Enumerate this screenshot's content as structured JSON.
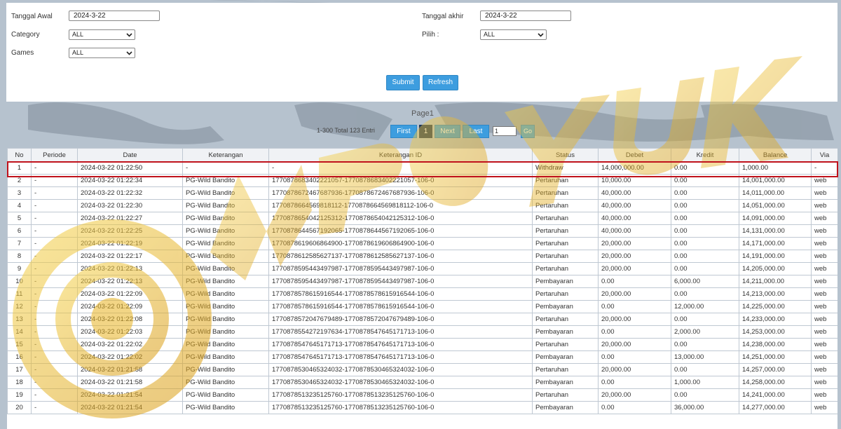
{
  "filters": {
    "start_date_label": "Tanggal Awal",
    "start_date_value": "2024-3-22",
    "end_date_label": "Tanggal akhir",
    "end_date_value": "2024-3-22",
    "category_label": "Category",
    "category_value": "ALL",
    "pilih_label": "Pilih  :",
    "pilih_value": "ALL",
    "games_label": "Games",
    "games_value": "ALL",
    "submit_label": "Submit",
    "refresh_label": "Refresh"
  },
  "pagination": {
    "page_title": "Page1",
    "total_text": "1-300 Total 123 Entri",
    "first_label": "First",
    "current_page": "1",
    "next_label": "Next",
    "last_label": "Last",
    "page_input_value": "1",
    "go_label": "Go"
  },
  "table": {
    "columns": [
      "No",
      "Periode",
      "Date",
      "Keterangan",
      "Keterangan ID",
      "Status",
      "Debet",
      "Kredit",
      "Balance",
      "Via"
    ],
    "rows": [
      [
        "1",
        "-",
        "2024-03-22 01:22:50",
        "-",
        "-",
        "Withdraw",
        "14,000,000.00",
        "0.00",
        "1,000.00",
        "-"
      ],
      [
        "2",
        "-",
        "2024-03-22 01:22:34",
        "PG-Wild Bandito",
        "1770878683402221057-1770878683402221057-106-0",
        "Pertaruhan",
        "10,000.00",
        "0.00",
        "14,001,000.00",
        "web"
      ],
      [
        "3",
        "-",
        "2024-03-22 01:22:32",
        "PG-Wild Bandito",
        "1770878672467687936-1770878672467687936-106-0",
        "Pertaruhan",
        "40,000.00",
        "0.00",
        "14,011,000.00",
        "web"
      ],
      [
        "4",
        "-",
        "2024-03-22 01:22:30",
        "PG-Wild Bandito",
        "1770878664569818112-1770878664569818112-106-0",
        "Pertaruhan",
        "40,000.00",
        "0.00",
        "14,051,000.00",
        "web"
      ],
      [
        "5",
        "-",
        "2024-03-22 01:22:27",
        "PG-Wild Bandito",
        "1770878654042125312-1770878654042125312-106-0",
        "Pertaruhan",
        "40,000.00",
        "0.00",
        "14,091,000.00",
        "web"
      ],
      [
        "6",
        "-",
        "2024-03-22 01:22:25",
        "PG-Wild Bandito",
        "1770878644567192065-1770878644567192065-106-0",
        "Pertaruhan",
        "40,000.00",
        "0.00",
        "14,131,000.00",
        "web"
      ],
      [
        "7",
        "-",
        "2024-03-22 01:22:19",
        "PG-Wild Bandito",
        "1770878619606864900-1770878619606864900-106-0",
        "Pertaruhan",
        "20,000.00",
        "0.00",
        "14,171,000.00",
        "web"
      ],
      [
        "8",
        "-",
        "2024-03-22 01:22:17",
        "PG-Wild Bandito",
        "1770878612585627137-1770878612585627137-106-0",
        "Pertaruhan",
        "20,000.00",
        "0.00",
        "14,191,000.00",
        "web"
      ],
      [
        "9",
        "-",
        "2024-03-22 01:22:13",
        "PG-Wild Bandito",
        "1770878595443497987-1770878595443497987-106-0",
        "Pertaruhan",
        "20,000.00",
        "0.00",
        "14,205,000.00",
        "web"
      ],
      [
        "10",
        "-",
        "2024-03-22 01:22:13",
        "PG-Wild Bandito",
        "1770878595443497987-1770878595443497987-106-0",
        "Pembayaran",
        "0.00",
        "6,000.00",
        "14,211,000.00",
        "web"
      ],
      [
        "11",
        "-",
        "2024-03-22 01:22:09",
        "PG-Wild Bandito",
        "1770878578615916544-1770878578615916544-106-0",
        "Pertaruhan",
        "20,000.00",
        "0.00",
        "14,213,000.00",
        "web"
      ],
      [
        "12",
        "-",
        "2024-03-22 01:22:09",
        "PG-Wild Bandito",
        "1770878578615916544-1770878578615916544-106-0",
        "Pembayaran",
        "0.00",
        "12,000.00",
        "14,225,000.00",
        "web"
      ],
      [
        "13",
        "-",
        "2024-03-22 01:22:08",
        "PG-Wild Bandito",
        "1770878572047679489-1770878572047679489-106-0",
        "Pertaruhan",
        "20,000.00",
        "0.00",
        "14,233,000.00",
        "web"
      ],
      [
        "14",
        "-",
        "2024-03-22 01:22:03",
        "PG-Wild Bandito",
        "1770878554272197634-1770878547645171713-106-0",
        "Pembayaran",
        "0.00",
        "2,000.00",
        "14,253,000.00",
        "web"
      ],
      [
        "15",
        "-",
        "2024-03-22 01:22:02",
        "PG-Wild Bandito",
        "1770878547645171713-1770878547645171713-106-0",
        "Pertaruhan",
        "20,000.00",
        "0.00",
        "14,238,000.00",
        "web"
      ],
      [
        "16",
        "-",
        "2024-03-22 01:22:02",
        "PG-Wild Bandito",
        "1770878547645171713-1770878547645171713-106-0",
        "Pembayaran",
        "0.00",
        "13,000.00",
        "14,251,000.00",
        "web"
      ],
      [
        "17",
        "-",
        "2024-03-22 01:21:58",
        "PG-Wild Bandito",
        "1770878530465324032-1770878530465324032-106-0",
        "Pertaruhan",
        "20,000.00",
        "0.00",
        "14,257,000.00",
        "web"
      ],
      [
        "18",
        "-",
        "2024-03-22 01:21:58",
        "PG-Wild Bandito",
        "1770878530465324032-1770878530465324032-106-0",
        "Pembayaran",
        "0.00",
        "1,000.00",
        "14,258,000.00",
        "web"
      ],
      [
        "19",
        "-",
        "2024-03-22 01:21:54",
        "PG-Wild Bandito",
        "1770878513235125760-1770878513235125760-106-0",
        "Pertaruhan",
        "20,000.00",
        "0.00",
        "14,241,000.00",
        "web"
      ],
      [
        "20",
        "-",
        "2024-03-22 01:21:54",
        "PG-Wild Bandito",
        "1770878513235125760-1770878513235125760-106-0",
        "Pembayaran",
        "0.00",
        "36,000.00",
        "14,277,000.00",
        "web"
      ]
    ]
  },
  "colors": {
    "button_blue": "#3d9ddf",
    "current_page": "#1d3557",
    "highlight_border": "#c0121c",
    "red_value": "#e02020",
    "watermark_gold": "#e8b422"
  },
  "watermark": {
    "text": "MPOYUK",
    "emblem_icon": "circle-logo-emblem"
  }
}
